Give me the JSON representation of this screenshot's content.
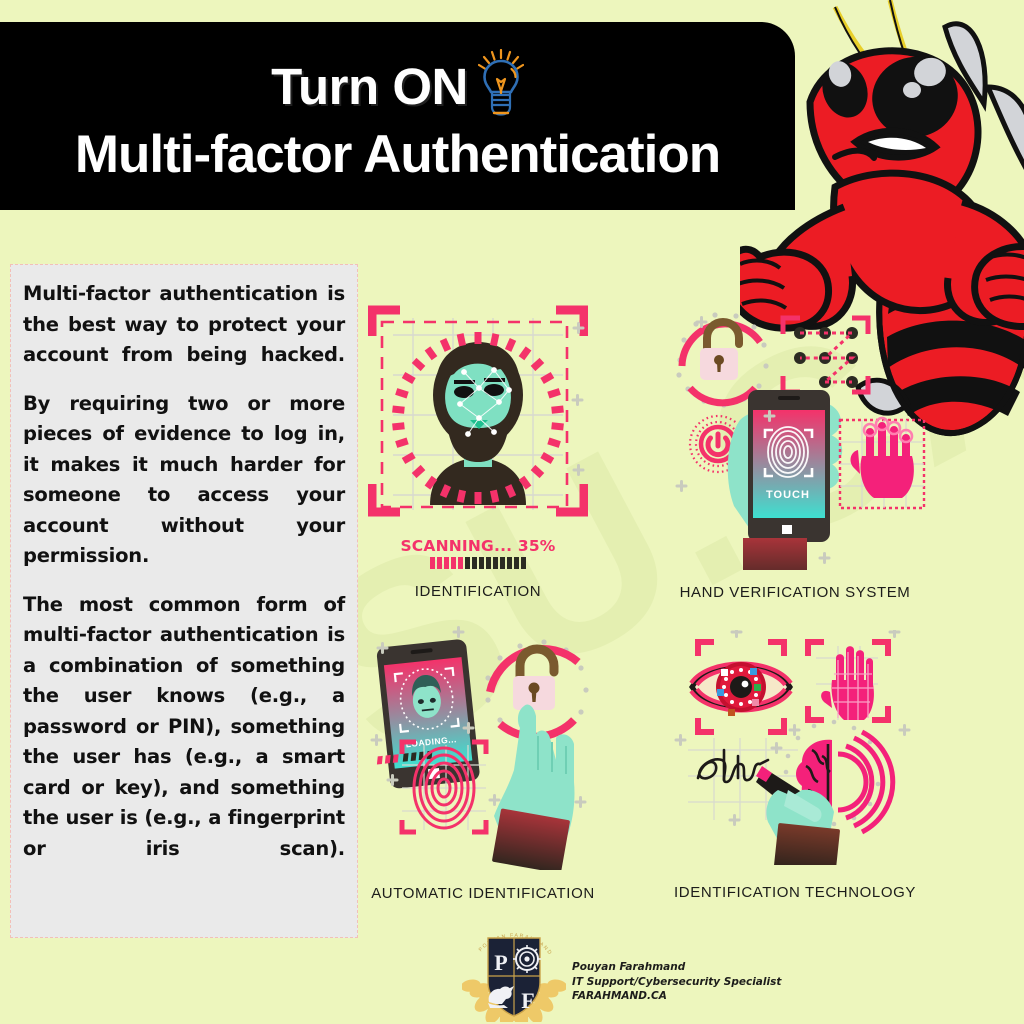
{
  "page": {
    "background_color": "#edf6bd",
    "accent_pink": "#f4326a",
    "header_bg": "#000000",
    "header_text_color": "#ffffff",
    "panel_bg": "#eaeaea",
    "panel_border": "#f2c0b8",
    "watermark_text": "SU.CA"
  },
  "header": {
    "title_line1": "Turn ON",
    "title_line2": "Multi-factor Authentication",
    "bulb_icon": "lightbulb-icon",
    "mascot": "angry-hornet-mascot"
  },
  "body_text": {
    "paragraphs": [
      "Multi-factor authentication is the best way to protect your account from being hacked.",
      "By requiring two or more pieces of evidence to log in, it makes it much harder for someone to access your account without your permission.",
      "The most common form of multi-factor authentication is a combination of something the user knows (e.g., a password or PIN), something the user has (e.g., a smart card or key), and something the user is (e.g., a fingerprint or iris scan)."
    ]
  },
  "figures": [
    {
      "id": "identification",
      "caption": "IDENTIFICATION",
      "status_text": "SCANNING... 35%",
      "progress_percent": 35,
      "progress_total_segments": 14,
      "progress_filled_segments": 5,
      "icon": "face-scan-icon"
    },
    {
      "id": "hand-verification-system",
      "caption": "HAND VERIFICATION SYSTEM",
      "screen_label": "TOUCH",
      "icon": "hand-fingerprint-phone-icon"
    },
    {
      "id": "automatic-identification",
      "caption": "AUTOMATIC IDENTIFICATION",
      "screen_label": "LOADING...",
      "icon": "face-unlock-fingerprint-icon"
    },
    {
      "id": "identification-technology",
      "caption": "IDENTIFICATION TECHNOLOGY",
      "icon": "iris-brain-signature-icon"
    }
  ],
  "footer": {
    "logo": "pf-shield-logo",
    "logo_arc_text": "POUYAN FARAHMAND",
    "logo_letters": [
      "P",
      "F"
    ],
    "name": "Pouyan Farahmand",
    "role": "IT Support/Cybersecurity Specialist",
    "website": "FARAHMAND.CA"
  }
}
